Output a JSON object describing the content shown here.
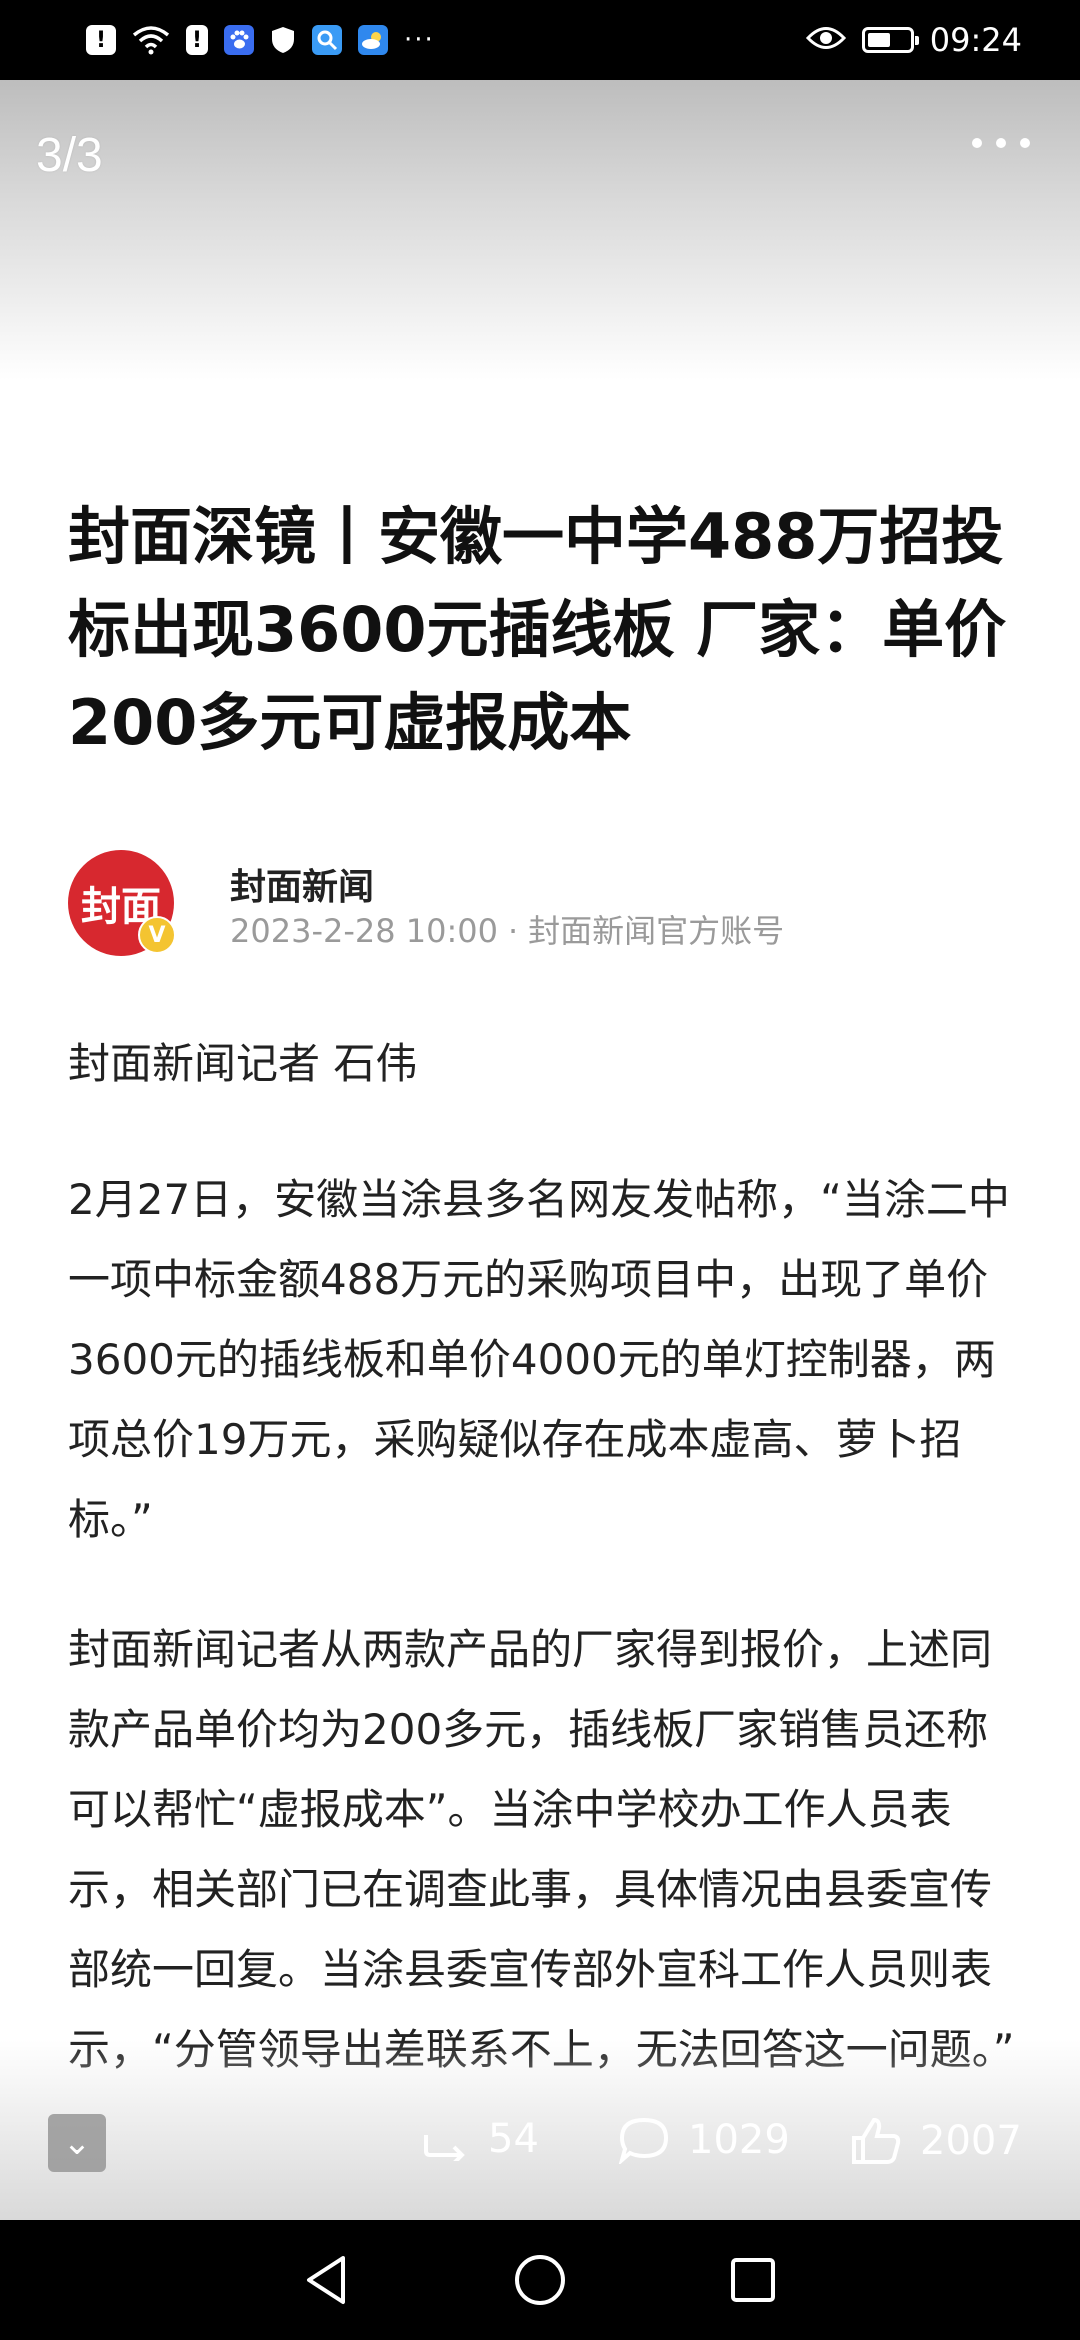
{
  "status_bar": {
    "time": "09:24",
    "battery_level": 0.55,
    "left_icons": [
      "alert-icon",
      "wifi-icon",
      "sim-alert-icon",
      "baidu-icon",
      "shield-icon",
      "search-app-icon",
      "weather-icon",
      "more-notifications-icon"
    ],
    "right_icons": [
      "eye-icon",
      "battery-icon"
    ]
  },
  "viewer": {
    "counter": "3/3"
  },
  "article": {
    "headline": "封面深镜丨安徽一中学488万招投标出现3600元插线板 厂家：单价200多元可虚报成本",
    "source": {
      "avatar_text": "封面",
      "badge": "V",
      "name": "封面新闻",
      "date": "2023-2-28 10:00",
      "separator": "·",
      "account": "封面新闻官方账号"
    },
    "byline": "封面新闻记者 石伟",
    "paragraphs": [
      "2月27日，安徽当涂县多名网友发帖称，“当涂二中一项中标金额488万元的采购项目中，出现了单价3600元的插线板和单价4000元的单灯控制器，两项总价19万元，采购疑似存在成本虚高、萝卜招标。”",
      "封面新闻记者从两款产品的厂家得到报价，上述同款产品单价均为200多元，插线板厂家销售员还称可以帮忙“虚报成本”。当涂中学校办工作人员表示，相关部门已在调查此事，具体情况由县委宣传部统一回复。当涂县委宣传部外宣科工作人员则表示，“分管领导出差联系不上，无法回答这一问题。”"
    ]
  },
  "actions": {
    "share_count": "54",
    "comment_count": "1029",
    "like_count": "2007"
  },
  "colors": {
    "brand_red": "#d7282f",
    "badge_yellow": "#f4c431"
  }
}
